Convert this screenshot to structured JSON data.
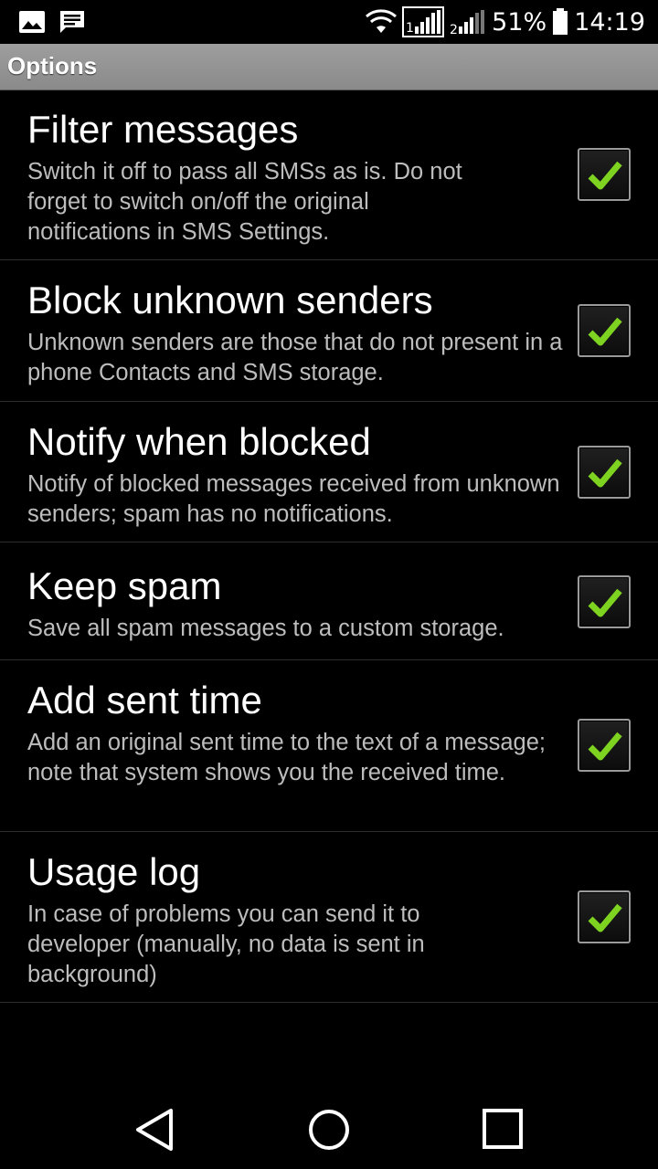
{
  "status_bar": {
    "battery_percent": "51%",
    "time": "14:19",
    "icons": [
      "image-icon",
      "message-icon",
      "wifi-icon",
      "signal-sim1-icon",
      "signal-sim2-icon",
      "battery-icon"
    ]
  },
  "header": {
    "title": "Options"
  },
  "options": [
    {
      "title": "Filter messages",
      "summary": "Switch it off to pass all SMSs as is. Do not forget to switch on/off the original notifications in SMS Settings.",
      "checked": true
    },
    {
      "title": "Block unknown senders",
      "summary": "Unknown senders are those that do not present in a phone Contacts and SMS storage.",
      "checked": true
    },
    {
      "title": "Notify when blocked",
      "summary": "Notify of blocked messages received from unknown senders; spam has no notifications.",
      "checked": true
    },
    {
      "title": "Keep spam",
      "summary": "Save all spam messages to a custom storage.",
      "checked": true
    },
    {
      "title": "Add sent time",
      "summary": "Add an original sent time to the text of a message; note that system shows you the received time.",
      "checked": true
    },
    {
      "title": "Usage log",
      "summary": "In case of problems you can send it to developer (manually, no data is sent in background)",
      "checked": true
    }
  ],
  "nav": {
    "icons": [
      "back-icon",
      "home-icon",
      "recents-icon"
    ]
  },
  "colors": {
    "check": "#7ed321",
    "header_bg": "#969696",
    "summary_text": "#bdbdbd"
  }
}
